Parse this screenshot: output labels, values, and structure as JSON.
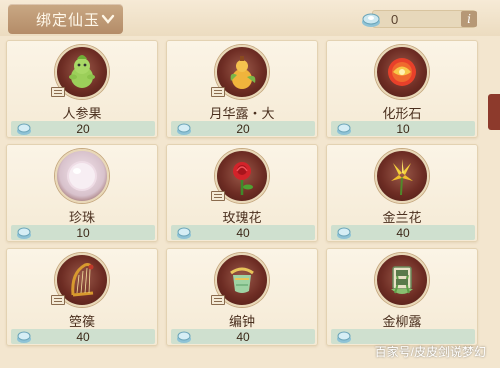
{
  "header": {
    "tab_label": "绑定仙玉",
    "currency_value": "0",
    "info_label": "i"
  },
  "items": [
    {
      "name": "人参果",
      "price": "20",
      "icon": "ginseng-fruit-icon"
    },
    {
      "name": "月华露・大",
      "price": "20",
      "icon": "moon-dew-gourd-icon"
    },
    {
      "name": "化形石",
      "price": "10",
      "icon": "transform-stone-icon"
    },
    {
      "name": "珍珠",
      "price": "10",
      "icon": "pearl-icon"
    },
    {
      "name": "玫瑰花",
      "price": "40",
      "icon": "rose-icon"
    },
    {
      "name": "金兰花",
      "price": "40",
      "icon": "golden-orchid-icon"
    },
    {
      "name": "箜篌",
      "price": "40",
      "icon": "harp-icon"
    },
    {
      "name": "编钟",
      "price": "40",
      "icon": "chime-bell-icon"
    },
    {
      "name": "金柳露",
      "price": "",
      "icon": "golden-willow-dew-icon"
    }
  ],
  "watermark": "百家号/皮皮剑说梦幻",
  "colors": {
    "background": "#f3e6cf",
    "tab": "#b48c68",
    "price_bar": "#cfe0cf",
    "icon_ring": "#6e2d24"
  }
}
